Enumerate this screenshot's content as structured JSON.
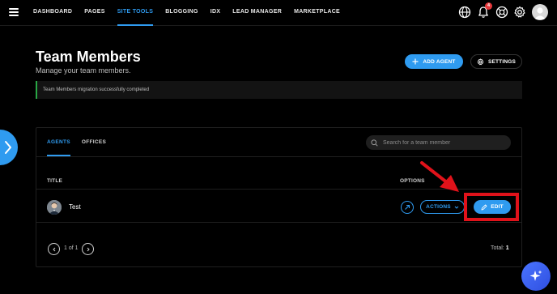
{
  "nav": {
    "items": [
      "DASHBOARD",
      "PAGES",
      "SITE TOOLS",
      "BLOGGING",
      "IDX",
      "LEAD MANAGER",
      "MARKETPLACE"
    ],
    "active": "SITE TOOLS",
    "notification_count": "4",
    "icons": [
      "globe-icon",
      "bell-icon",
      "support-icon",
      "gear-icon",
      "user-avatar"
    ]
  },
  "header": {
    "title": "Team Members",
    "subtitle": "Manage your team members.",
    "add_agent_label": "ADD AGENT",
    "settings_label": "SETTINGS"
  },
  "alert": {
    "message": "Team Members migration successfully completed"
  },
  "tabs": [
    "AGENTS",
    "OFFICES"
  ],
  "active_tab": "AGENTS",
  "search": {
    "placeholder": "Search for a team member"
  },
  "table": {
    "columns": {
      "title": "TITLE",
      "options": "OPTIONS"
    },
    "rows": [
      {
        "name": "Test",
        "actions_label": "ACTIONS",
        "edit_label": "EDIT"
      }
    ]
  },
  "pagination": {
    "label": "1 of 1",
    "total_label": "Total:",
    "total_value": "1"
  },
  "colors": {
    "accent": "#2f9bf0",
    "highlight": "#e0121a",
    "success": "#28a745",
    "background": "#000000"
  }
}
